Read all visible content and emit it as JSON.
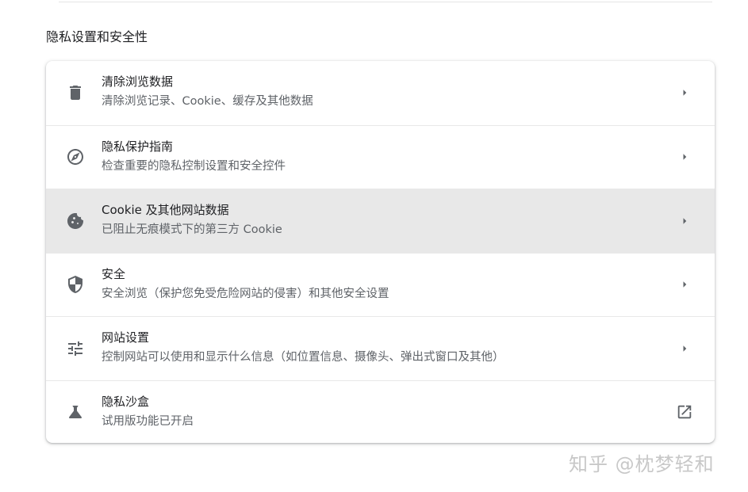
{
  "section": {
    "title": "隐私设置和安全性"
  },
  "rows": [
    {
      "title": "清除浏览数据",
      "subtitle": "清除浏览记录、Cookie、缓存及其他数据",
      "icon": "trash-icon",
      "trail": "arrow-right-icon"
    },
    {
      "title": "隐私保护指南",
      "subtitle": "检查重要的隐私控制设置和安全控件",
      "icon": "compass-icon",
      "trail": "arrow-right-icon"
    },
    {
      "title": "Cookie 及其他网站数据",
      "subtitle": "已阻止无痕模式下的第三方 Cookie",
      "icon": "cookie-icon",
      "trail": "arrow-right-icon"
    },
    {
      "title": "安全",
      "subtitle": "安全浏览（保护您免受危险网站的侵害）和其他安全设置",
      "icon": "shield-icon",
      "trail": "arrow-right-icon"
    },
    {
      "title": "网站设置",
      "subtitle": "控制网站可以使用和显示什么信息（如位置信息、摄像头、弹出式窗口及其他）",
      "icon": "tune-icon",
      "trail": "arrow-right-icon"
    },
    {
      "title": "隐私沙盒",
      "subtitle": "试用版功能已开启",
      "icon": "flask-icon",
      "trail": "external-link-icon"
    }
  ],
  "watermark": {
    "text": "知乎 @枕梦轻和"
  }
}
